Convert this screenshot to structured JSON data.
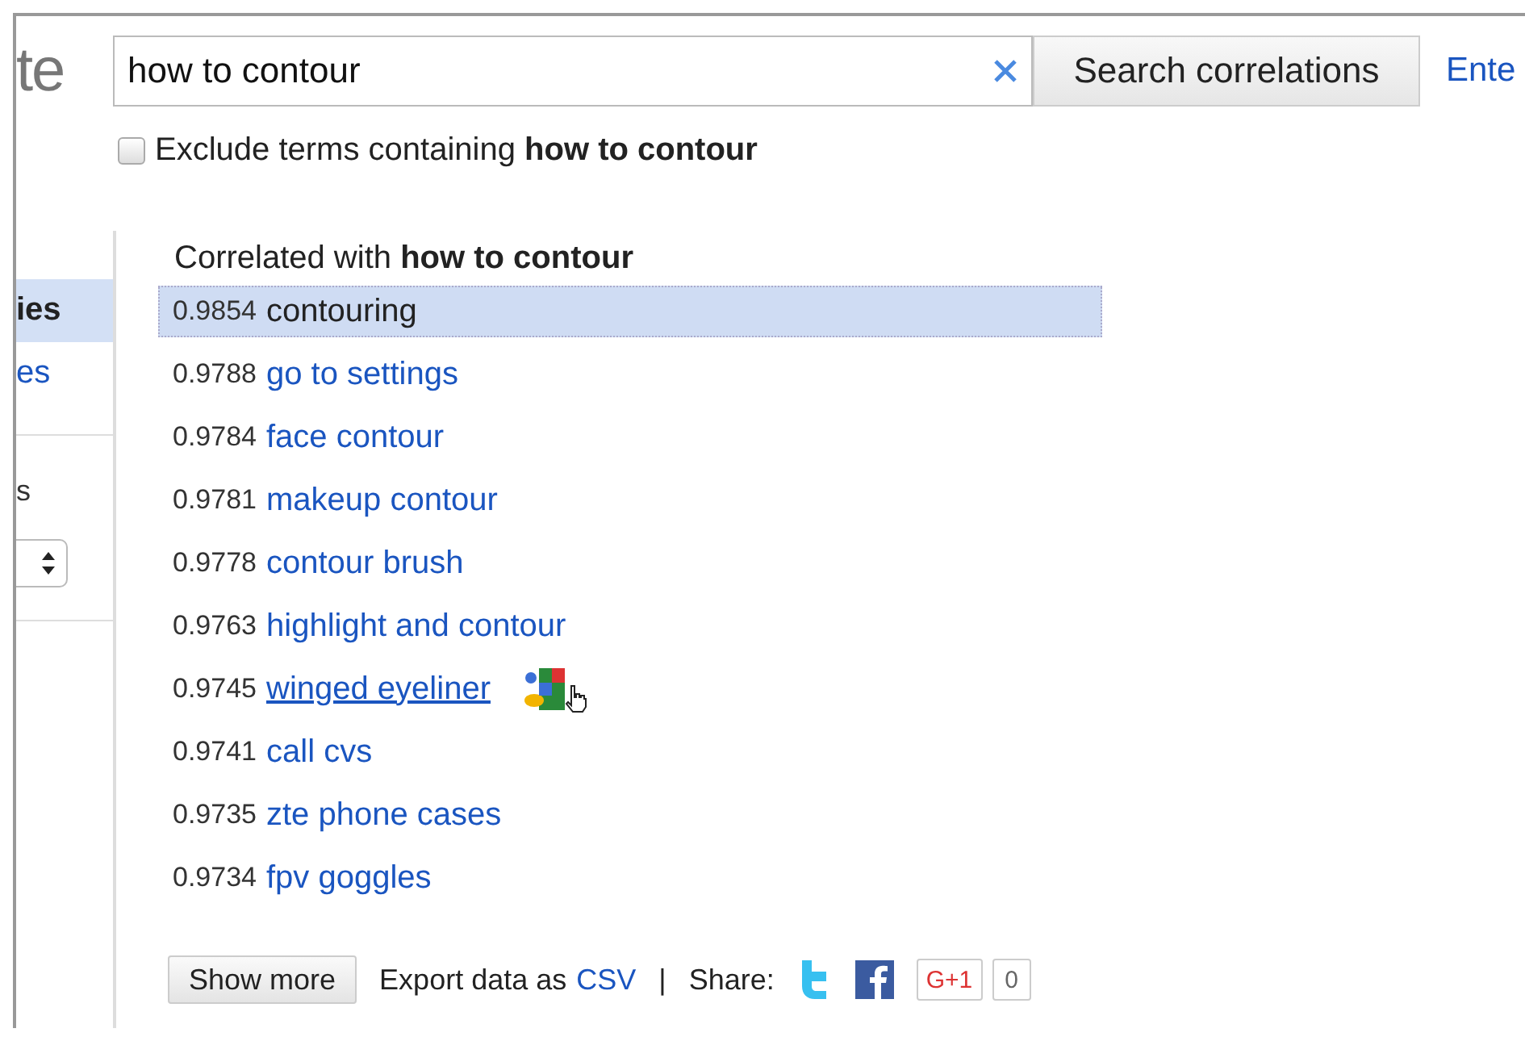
{
  "logo_fragment": "te",
  "search": {
    "value": "how to contour",
    "button": "Search correlations"
  },
  "header_link": "Ente",
  "exclude": {
    "label": "Exclude terms containing **how to contour**",
    "checked": false
  },
  "sidebar": {
    "items": [
      {
        "label": "ies",
        "selected": true
      },
      {
        "label": "es",
        "selected": false
      }
    ],
    "section_label": "s"
  },
  "results": {
    "heading": "Correlated with **how to contour**",
    "rows": [
      {
        "score": "0.9854",
        "term": "contouring",
        "selected": true,
        "hovered": false
      },
      {
        "score": "0.9788",
        "term": "go to settings",
        "selected": false,
        "hovered": false
      },
      {
        "score": "0.9784",
        "term": "face contour",
        "selected": false,
        "hovered": false
      },
      {
        "score": "0.9781",
        "term": "makeup contour",
        "selected": false,
        "hovered": false
      },
      {
        "score": "0.9778",
        "term": "contour brush",
        "selected": false,
        "hovered": false
      },
      {
        "score": "0.9763",
        "term": "highlight and contour",
        "selected": false,
        "hovered": false
      },
      {
        "score": "0.9745",
        "term": "winged eyeliner",
        "selected": false,
        "hovered": true
      },
      {
        "score": "0.9741",
        "term": "call cvs",
        "selected": false,
        "hovered": false
      },
      {
        "score": "0.9735",
        "term": "zte phone cases",
        "selected": false,
        "hovered": false
      },
      {
        "score": "0.9734",
        "term": "fpv goggles",
        "selected": false,
        "hovered": false
      }
    ]
  },
  "footer": {
    "button": "Show more",
    "export_text": "Export data as",
    "export_link": "CSV",
    "separator": "|",
    "share_label": "Share:",
    "plus_one": "G+1",
    "plus_one_count": "0"
  }
}
